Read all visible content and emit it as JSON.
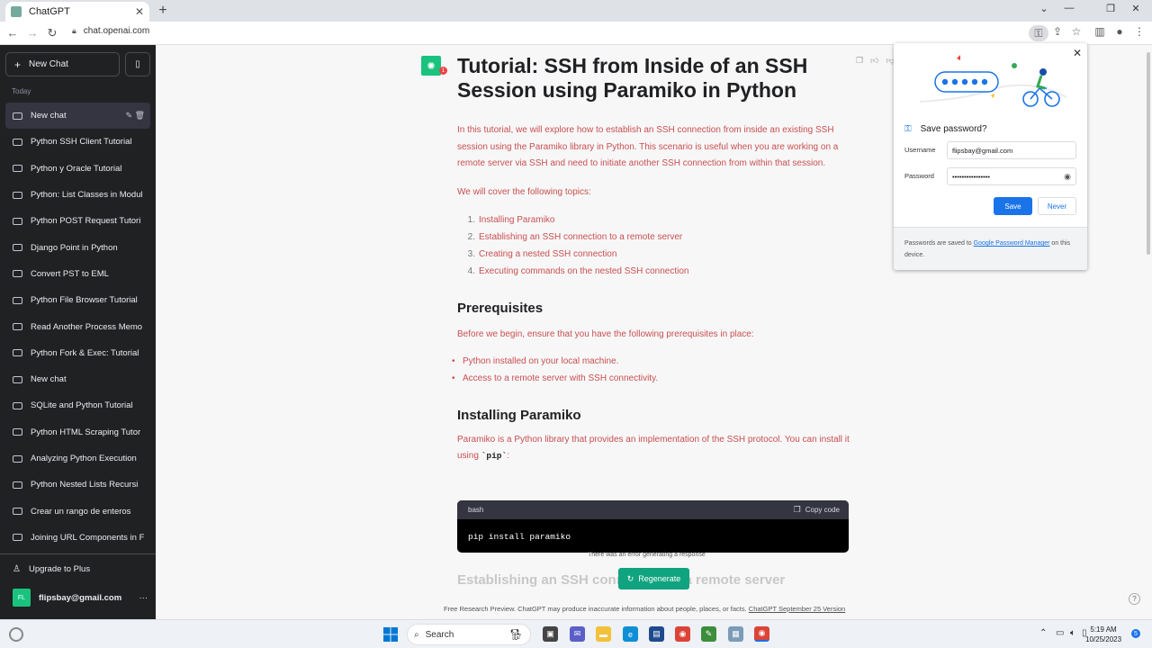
{
  "browser": {
    "tab_title": "ChatGPT",
    "tab_close": "✕",
    "new_tab": "+",
    "url": "chat.openai.com"
  },
  "sidebar": {
    "new_chat_label": "New Chat",
    "section_label": "Today",
    "items": [
      {
        "label": "New chat",
        "active": true
      },
      {
        "label": "Python SSH Client Tutorial"
      },
      {
        "label": "Python y Oracle Tutorial"
      },
      {
        "label": "Python: List Classes in Modul"
      },
      {
        "label": "Python POST Request Tutori"
      },
      {
        "label": "Django Point in Python"
      },
      {
        "label": "Convert PST to EML"
      },
      {
        "label": "Python File Browser Tutorial"
      },
      {
        "label": "Read Another Process Memo"
      },
      {
        "label": "Python Fork & Exec: Tutorial"
      },
      {
        "label": "New chat"
      },
      {
        "label": "SQLite and Python Tutorial"
      },
      {
        "label": "Python HTML Scraping Tutor"
      },
      {
        "label": "Analyzing Python Execution"
      },
      {
        "label": "Python Nested Lists Recursi"
      },
      {
        "label": "Crear un rango de enteros"
      },
      {
        "label": "Joining URL Components in F"
      }
    ],
    "upgrade_label": "Upgrade to Plus",
    "user_initials": "FL",
    "user_email": "flipsbay@gmail.com",
    "more": "···"
  },
  "main": {
    "badge_count": "1",
    "title": "Tutorial: SSH from Inside of an SSH Session using Paramiko in Python",
    "intro": "In this tutorial, we will explore how to establish an SSH connection from inside an existing SSH session using the Paramiko library in Python. This scenario is useful when you are working on a remote server via SSH and need to initiate another SSH connection from within that session.",
    "topics_intro": "We will cover the following topics:",
    "topics": [
      {
        "num": "1.",
        "text": "Installing Paramiko"
      },
      {
        "num": "2.",
        "text": "Establishing an SSH connection to a remote server"
      },
      {
        "num": "3.",
        "text": "Creating a nested SSH connection"
      },
      {
        "num": "4.",
        "text": "Executing commands on the nested SSH connection"
      }
    ],
    "prereq_heading": "Prerequisites",
    "prereq_intro": "Before we begin, ensure that you have the following prerequisites in place:",
    "prereqs": [
      "Python installed on your local machine.",
      "Access to a remote server with SSH connectivity."
    ],
    "install_heading": "Installing Paramiko",
    "install_text_1": "Paramiko is a Python library that provides an implementation of the SSH protocol. You can install it using ",
    "install_code": "`pip`",
    "install_text_2": ":",
    "code_lang": "bash",
    "copy_code_label": "Copy code",
    "code": "pip install paramiko",
    "error_text": "There was an error generating a response",
    "next_heading": "Establishing an SSH connection to a remote server",
    "regenerate_label": "Regenerate",
    "footer_text": "Free Research Preview. ChatGPT may produce inaccurate information about people, places, or facts. ",
    "footer_link": "ChatGPT September 25 Version",
    "help": "?"
  },
  "password_popup": {
    "title": "Save password?",
    "username_label": "Username",
    "username_value": "flipsbay@gmail.com",
    "password_label": "Password",
    "password_value": "••••••••••••••••",
    "save_label": "Save",
    "never_label": "Never",
    "footer_1": "Passwords are saved to ",
    "footer_link": "Google Password Manager",
    "footer_2": " on this device."
  },
  "taskbar": {
    "search_label": "Search",
    "time": "5:19 AM",
    "date": "10/25/2023",
    "notifications": "5"
  },
  "colors": {
    "sidebar_bg": "#202123",
    "accent_green": "#10a37f",
    "text_red": "#c94f4f",
    "chrome_blue": "#1a73e8"
  }
}
